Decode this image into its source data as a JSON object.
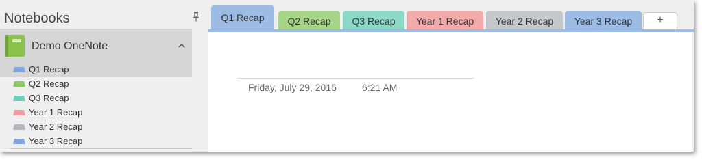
{
  "notebooks_pane": {
    "title": "Notebooks",
    "notebook": {
      "name": "Demo OneNote",
      "color": "#8bc34a"
    },
    "sections": [
      {
        "label": "Q1 Recap",
        "color": "#7fa7dd",
        "selected": true
      },
      {
        "label": "Q2 Recap",
        "color": "#8fca6a",
        "selected": false
      },
      {
        "label": "Q3 Recap",
        "color": "#6ccdb8",
        "selected": false
      },
      {
        "label": "Year 1 Recap",
        "color": "#ef9e9e",
        "selected": false
      },
      {
        "label": "Year 2 Recap",
        "color": "#b2b7c0",
        "selected": false
      },
      {
        "label": "Year 3 Recap",
        "color": "#7fa7dd",
        "selected": false
      }
    ]
  },
  "tabs": [
    {
      "label": "Q1 Recap",
      "color": "#9cbce6",
      "active": true
    },
    {
      "label": "Q2 Recap",
      "color": "#a6d58a",
      "active": false
    },
    {
      "label": "Q3 Recap",
      "color": "#8cd8c8",
      "active": false
    },
    {
      "label": "Year 1 Recap",
      "color": "#f2aaaa",
      "active": false
    },
    {
      "label": "Year 2 Recap",
      "color": "#c4c7cc",
      "active": false
    },
    {
      "label": "Year 3 Recap",
      "color": "#9cbce6",
      "active": false
    }
  ],
  "add_tab_label": "+",
  "page": {
    "date": "Friday, July 29, 2016",
    "time": "6:21 AM"
  }
}
